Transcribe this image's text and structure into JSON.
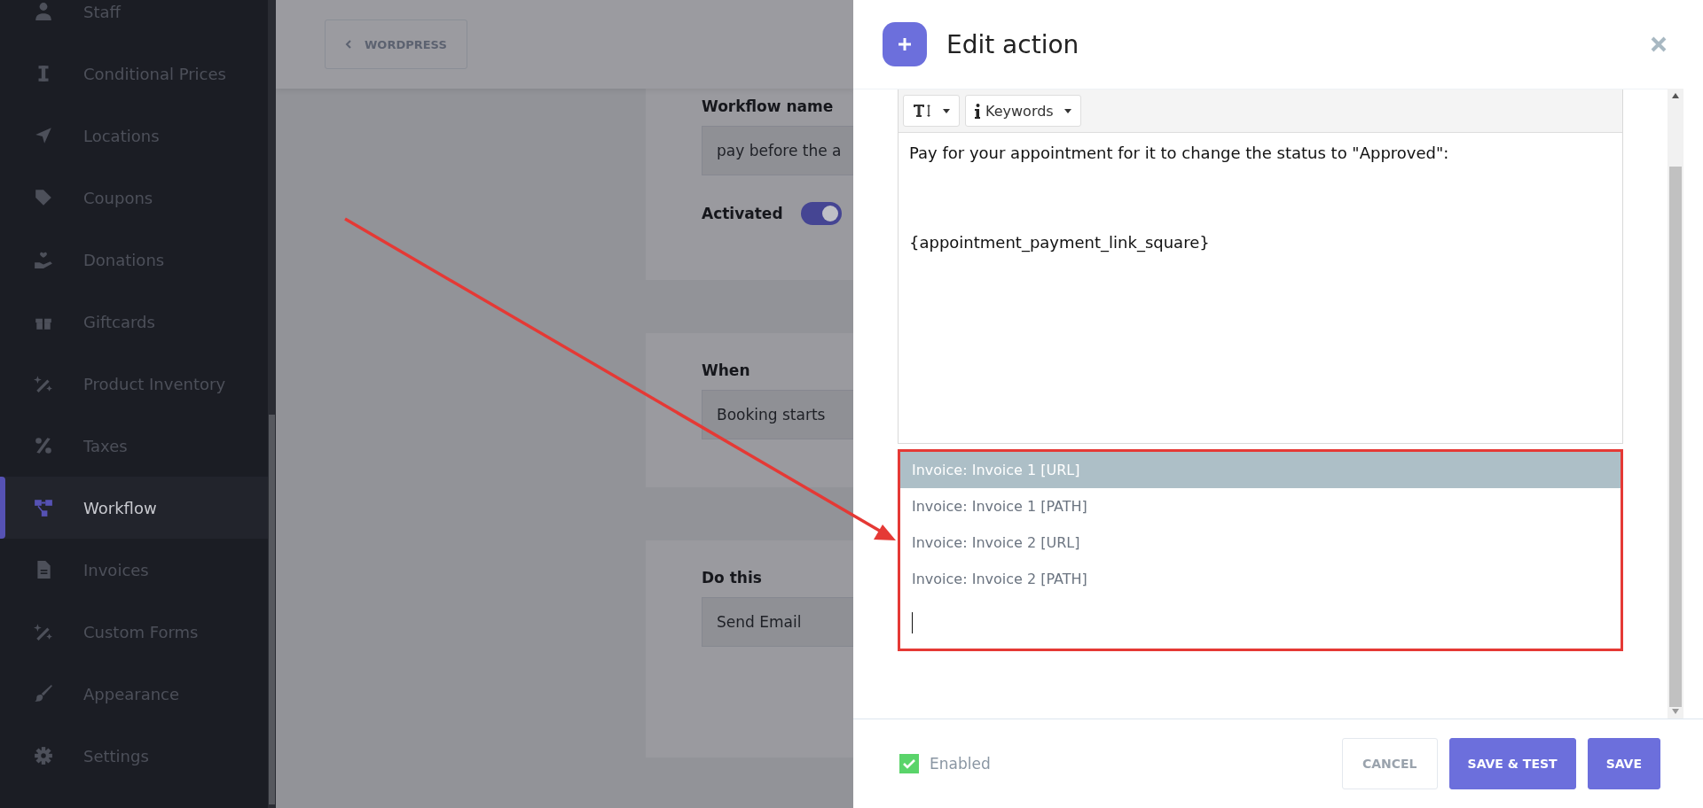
{
  "sidebar": {
    "items": [
      {
        "label": "Staff",
        "selected": false
      },
      {
        "label": "Conditional Prices",
        "selected": false
      },
      {
        "label": "Locations",
        "selected": false
      },
      {
        "label": "Coupons",
        "selected": false
      },
      {
        "label": "Donations",
        "selected": false
      },
      {
        "label": "Giftcards",
        "selected": false
      },
      {
        "label": "Product Inventory",
        "selected": false
      },
      {
        "label": "Taxes",
        "selected": false
      },
      {
        "label": "Workflow",
        "selected": true
      },
      {
        "label": "Invoices",
        "selected": false
      },
      {
        "label": "Custom Forms",
        "selected": false
      },
      {
        "label": "Appearance",
        "selected": false
      },
      {
        "label": "Settings",
        "selected": false
      }
    ]
  },
  "top_bar": {
    "back_button": "WORDPRESS"
  },
  "workflow": {
    "name_label": "Workflow name",
    "name_value": "pay before the a",
    "activated_label": "Activated",
    "activated": {
      "on": true
    },
    "when_label": "When",
    "when_value": "Booking starts",
    "do_label": "Do this",
    "do_value": "Send Email"
  },
  "panel": {
    "title": "Edit action",
    "toolbar": {
      "keywords": "Keywords"
    },
    "body_paragraphs": [
      "Pay for your appointment for it to change the status to \"Approved\":",
      "{appointment_payment_link_square}"
    ],
    "suggestions": [
      {
        "label": "Invoice: Invoice 1 [URL]",
        "selected": true
      },
      {
        "label": "Invoice: Invoice 1 [PATH]",
        "selected": false
      },
      {
        "label": "Invoice: Invoice 2 [URL]",
        "selected": false
      },
      {
        "label": "Invoice: Invoice 2 [PATH]",
        "selected": false
      }
    ],
    "enabled": {
      "label": "Enabled",
      "checked": true
    },
    "buttons": [
      {
        "label": "CANCEL",
        "kind": "secondary"
      },
      {
        "label": "SAVE & TEST",
        "kind": "primary"
      },
      {
        "label": "SAVE",
        "kind": "primary"
      }
    ]
  }
}
